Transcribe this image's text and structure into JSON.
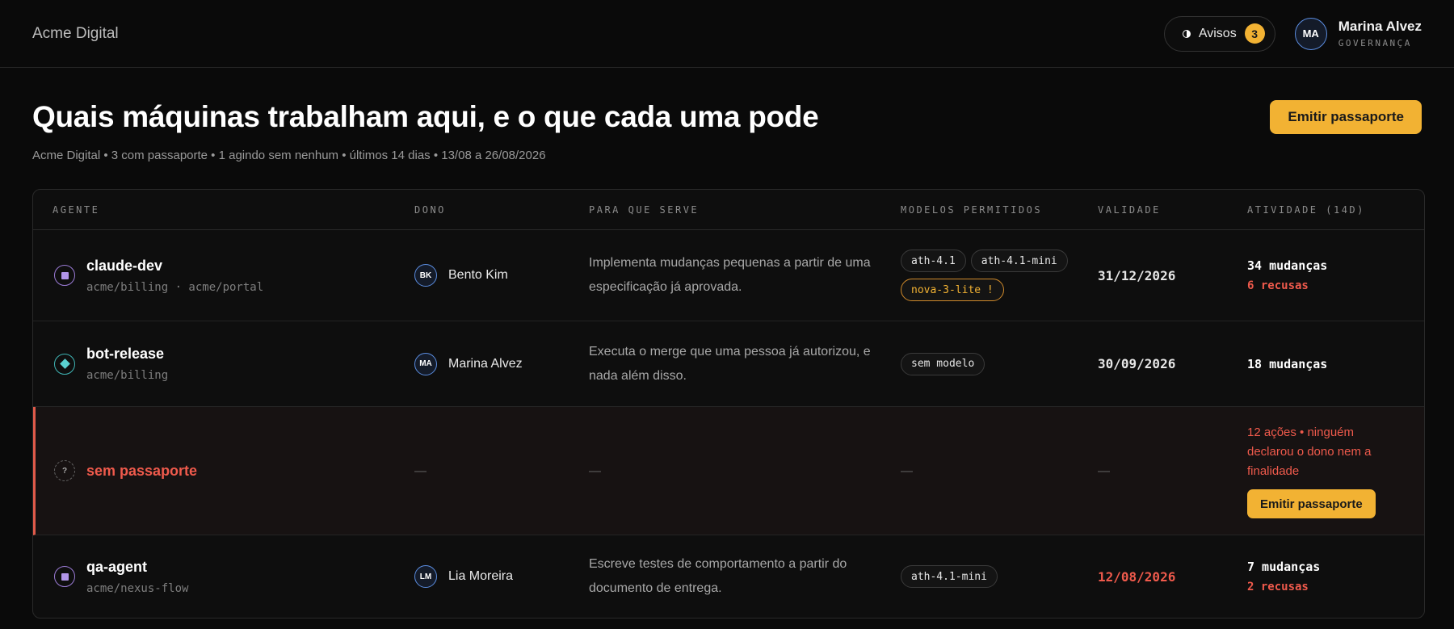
{
  "topbar": {
    "brand": "Acme Digital",
    "notices_label": "Avisos",
    "notices_count": "3",
    "user": {
      "initials": "MA",
      "name": "Marina Alvez",
      "role": "GOVERNANÇA"
    }
  },
  "header": {
    "title": "Quais máquinas trabalham aqui, e o que cada uma pode",
    "subtitle": "Acme Digital • 3 com passaporte • 1 agindo sem nenhum • últimos 14 dias • 13/08 a 26/08/2026",
    "issue_button": "Emitir passaporte"
  },
  "table": {
    "columns": [
      "AGENTE",
      "DONO",
      "PARA QUE SERVE",
      "MODELOS PERMITIDOS",
      "VALIDADE",
      "ATIVIDADE (14D)"
    ],
    "rows": [
      {
        "agent": "claude-dev",
        "repos": "acme/billing · acme/portal",
        "owner_initials": "BK",
        "owner": "Bento Kim",
        "purpose": "Implementa mudanças pequenas a partir de uma especificação já aprovada.",
        "models": [
          "ath-4.1",
          "ath-4.1-mini",
          "nova-3-lite !"
        ],
        "validity": "31/12/2026",
        "activity": "34 mudanças",
        "refusals": "6 recusas"
      },
      {
        "agent": "bot-release",
        "repos": "acme/billing",
        "owner_initials": "MA",
        "owner": "Marina Alvez",
        "purpose": "Executa o merge que uma pessoa já autorizou, e nada além disso.",
        "models": [
          "sem modelo"
        ],
        "validity": "30/09/2026",
        "activity": "18 mudanças"
      },
      {
        "agent": "sem passaporte",
        "icon_glyph": "?",
        "placeholder": "—",
        "warning": "12 ações • ninguém declarou o dono nem a finalidade",
        "button": "Emitir passaporte"
      },
      {
        "agent": "qa-agent",
        "repos": "acme/nexus-flow",
        "owner_initials": "LM",
        "owner": "Lia Moreira",
        "purpose": "Escreve testes de comportamento a partir do documento de entrega.",
        "models": [
          "ath-4.1-mini"
        ],
        "validity": "12/08/2026",
        "activity": "7 mudanças",
        "refusals": "2 recusas"
      }
    ]
  },
  "colors": {
    "accent": "#f2b233",
    "danger": "#ef5a4c",
    "background": "#0a0a0a"
  }
}
